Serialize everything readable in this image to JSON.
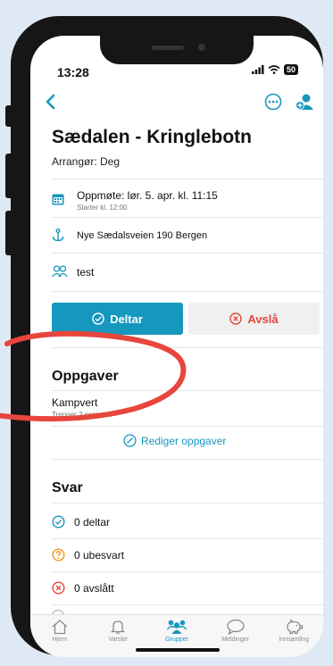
{
  "status_bar": {
    "time": "13:28",
    "battery": "50"
  },
  "event": {
    "title": "Sædalen - Kringlebotn",
    "organizer": "Arrangør: Deg",
    "meeting": "Oppmøte: lør. 5. apr. kl. 11:15",
    "starts": "Starter kl. 12:00",
    "address": "Nye Sædalsveien 190 Bergen",
    "group": "test"
  },
  "actions": {
    "join_label": "Deltar",
    "decline_label": "Avslå"
  },
  "tasks": {
    "heading": "Oppgaver",
    "items": [
      {
        "name": "Kampvert",
        "sub": "Trenger 2 personer"
      }
    ],
    "edit_label": "Rediger oppgaver"
  },
  "responses": {
    "heading": "Svar",
    "items": [
      {
        "label": "0 deltar",
        "color": "#1697be"
      },
      {
        "label": "0 ubesvart",
        "color": "#f29a1d"
      },
      {
        "label": "0 avslått",
        "color": "#e4463f"
      }
    ]
  },
  "tabs": [
    {
      "label": "Hjem",
      "icon": "home-icon"
    },
    {
      "label": "Varsler",
      "icon": "bell-icon"
    },
    {
      "label": "Grupper",
      "icon": "group-icon",
      "active": true
    },
    {
      "label": "Meldinger",
      "icon": "chat-icon"
    },
    {
      "label": "Innsamling",
      "icon": "piggy-bank-icon"
    }
  ],
  "colors": {
    "accent": "#1697be",
    "danger": "#e4463f",
    "warning": "#f29a1d",
    "annotation": "#e8453c"
  }
}
